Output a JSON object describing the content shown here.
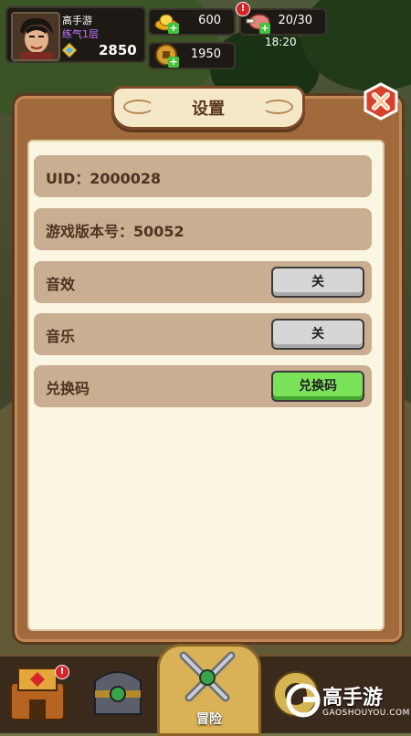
{
  "player": {
    "name": "高手游",
    "rank": "练气1层",
    "power": "2850"
  },
  "resources": {
    "gold": "600",
    "coins": "1950",
    "stamina": "20/30",
    "time": "18:20",
    "stamina_alert": "!"
  },
  "dialog": {
    "title": "设置",
    "uid": "UID：2000028",
    "version": "游戏版本号：50052",
    "sound_label": "音效",
    "sound_toggle": "关",
    "music_label": "音乐",
    "music_toggle": "关",
    "redeem_label": "兑换码",
    "redeem_button": "兑换码"
  },
  "nav": {
    "adventure_label": "冒险",
    "alert": "!"
  },
  "watermark": {
    "brand": "高手游",
    "url": "GAOSHOUYOU.COM"
  },
  "colors": {
    "panel": "#a06a3d",
    "row": "#c9ae91",
    "redeem": "#7be35a",
    "toggle": "#d6d6d6"
  }
}
